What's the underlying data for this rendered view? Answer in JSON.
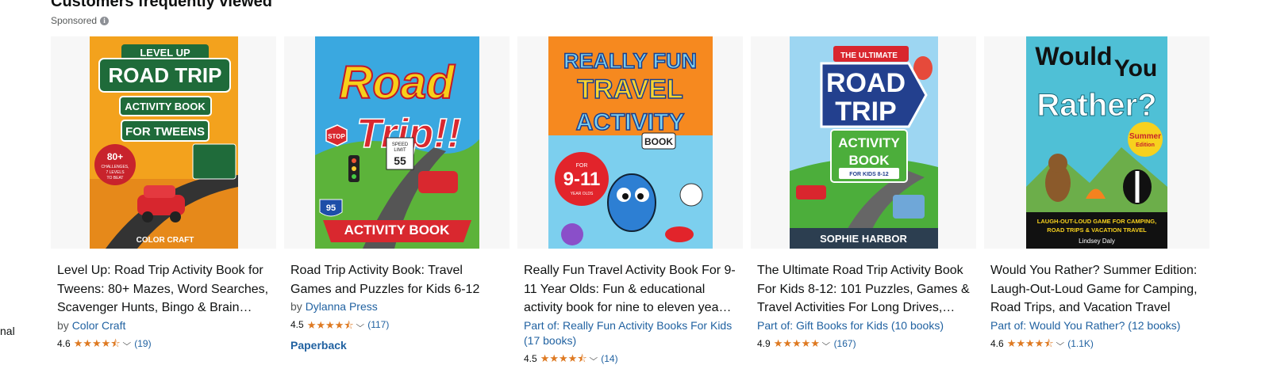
{
  "section": {
    "heading": "Customers frequently viewed",
    "sponsored_label": "Sponsored",
    "info_glyph": "i",
    "left_clip_text": "nal"
  },
  "cards": [
    {
      "title": "Level Up: Road Trip Activity Book for Tweens: 80+ Mazes, Word Searches, Scavenger Hunts, Bingo & Brain…",
      "by_prefix": "by",
      "author": "Color Craft",
      "rating_value": "4.6",
      "rating_stars": 4.5,
      "review_count": "(19)",
      "cover": {
        "line1": "LEVEL UP",
        "line2": "ROAD TRIP",
        "line3": "ACTIVITY BOOK",
        "line4": "FOR TWEENS",
        "badge1": "80+",
        "badge2": "CHALLENGES,",
        "badge3": "7 LEVELS",
        "badge4": "TO BEAT",
        "footer": "COLOR CRAFT",
        "colors": {
          "bg": "#f3a21d",
          "sign": "#1f6b3a"
        }
      }
    },
    {
      "title": "Road Trip Activity Book: Travel Games and Puzzles for Kids 6-12",
      "by_prefix": "by",
      "author": "Dylanna Press",
      "rating_value": "4.5",
      "rating_stars": 4.5,
      "review_count": "(117)",
      "format": "Paperback",
      "cover": {
        "line1": "Road",
        "line2": "Trip!!",
        "line3": "ACTIVITY BOOK",
        "stop": "STOP",
        "speed1": "SPEED",
        "speed2": "LIMIT",
        "speed3": "55",
        "route": "95",
        "colors": {
          "sky": "#3aa8e0",
          "banner": "#d9282f"
        }
      }
    },
    {
      "title": "Really Fun Travel Activity Book For 9-11 Year Olds: Fun & educational activity book for nine to eleven yea…",
      "series_prefix": "Part of:",
      "series": "Really Fun Activity Books For Kids (17 books)",
      "rating_value": "4.5",
      "rating_stars": 4.5,
      "review_count": "(14)",
      "cover": {
        "line1": "REALLY FUN",
        "line2": "TRAVEL",
        "line3": "ACTIVITY",
        "line4": "BOOK",
        "for": "FOR",
        "ages": "9-11",
        "year": "YEAR OLDS",
        "colors": {
          "bg": "#f6891f",
          "sky": "#7ccfee"
        }
      }
    },
    {
      "title": "The Ultimate Road Trip Activity Book For Kids 8-12: 101 Puzzles, Games & Travel Activities For Long Drives,…",
      "series_prefix": "Part of:",
      "series": "Gift Books for Kids (10 books)",
      "rating_value": "4.9",
      "rating_stars": 5,
      "review_count": "(167)",
      "cover": {
        "line1": "THE ULTIMATE",
        "line2": "ROAD",
        "line3": "TRIP",
        "line4": "ACTIVITY",
        "line5": "BOOK",
        "line6": "FOR KIDS 8-12",
        "footer": "SOPHIE HARBOR",
        "colors": {
          "sky": "#9dd6f2",
          "sign": "#23408e",
          "green": "#4cae3b"
        }
      }
    },
    {
      "title": "Would You Rather? Summer Edition: Laugh-Out-Loud Game for Camping, Road Trips, and Vacation Travel",
      "series_prefix": "Part of:",
      "series": "Would You Rather? (12 books)",
      "rating_value": "4.6",
      "rating_stars": 4.5,
      "review_count": "(1.1K)",
      "cover": {
        "line1": "Would",
        "line2": "You",
        "line3": "Rather?",
        "badge1": "Summer",
        "badge2": "Edition",
        "tag1": "LAUGH-OUT-LOUD GAME FOR CAMPING,",
        "tag2": "ROAD TRIPS & VACATION TRAVEL",
        "author": "Lindsey Daly",
        "colors": {
          "bg": "#4fc0d6",
          "ground": "#111111"
        }
      }
    }
  ],
  "theme": {
    "link": "#2162a1",
    "star": "#de7921",
    "text": "#0f1111",
    "muted": "#565959"
  }
}
